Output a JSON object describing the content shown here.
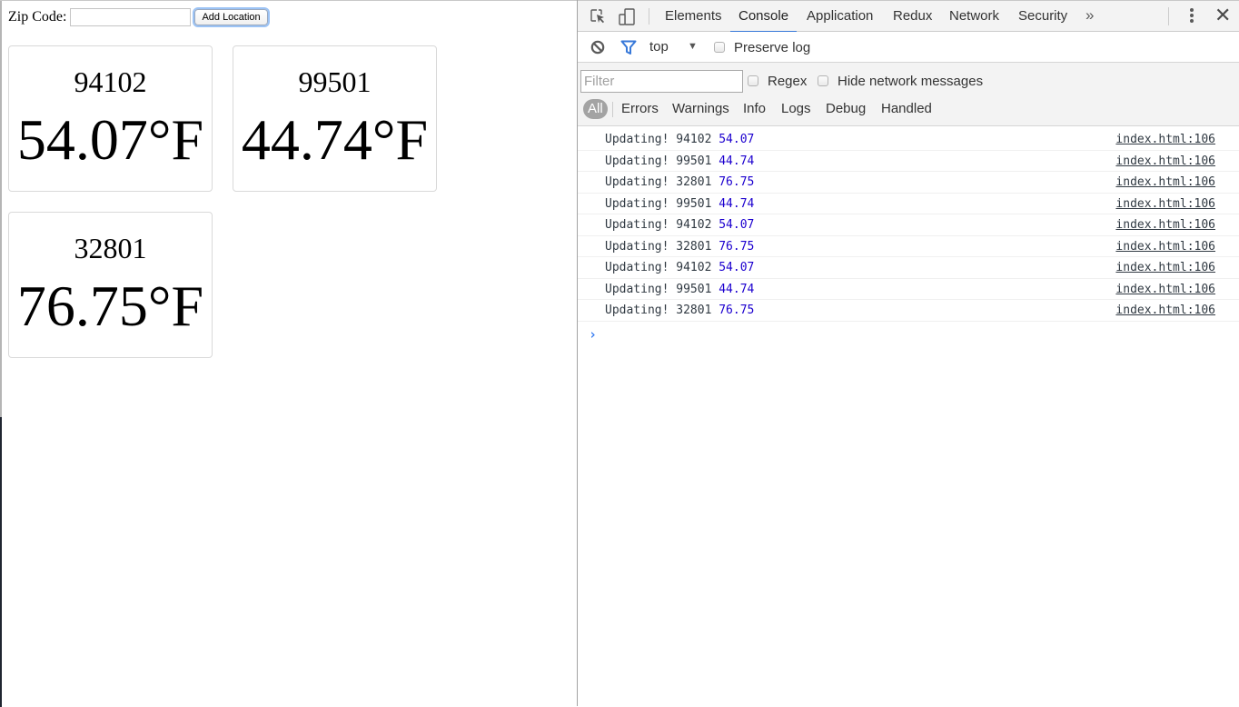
{
  "page": {
    "zip_label": "Zip Code:",
    "zip_input_value": "",
    "add_button_label": "Add Location",
    "locations": [
      {
        "zip": "94102",
        "temp": "54.07°F"
      },
      {
        "zip": "99501",
        "temp": "44.74°F"
      },
      {
        "zip": "32801",
        "temp": "76.75°F"
      }
    ]
  },
  "devtools": {
    "tabs": [
      {
        "label": "Elements",
        "active": false
      },
      {
        "label": "Console",
        "active": true
      },
      {
        "label": "Application",
        "active": false
      },
      {
        "label": "Redux",
        "active": false
      },
      {
        "label": "Network",
        "active": false
      },
      {
        "label": "Security",
        "active": false
      }
    ],
    "more_tabs_icon": "»",
    "toolbar": {
      "context": "top",
      "preserve_log_label": "Preserve log",
      "preserve_log_checked": false
    },
    "filter": {
      "placeholder": "Filter",
      "value": "",
      "regex_label": "Regex",
      "hide_network_label": "Hide network messages"
    },
    "levels": [
      "All",
      "Errors",
      "Warnings",
      "Info",
      "Logs",
      "Debug",
      "Handled"
    ],
    "active_level": "All",
    "messages": [
      {
        "prefix": "Updating! 94102",
        "value": "54.07",
        "source": "index.html:106"
      },
      {
        "prefix": "Updating! 99501",
        "value": "44.74",
        "source": "index.html:106"
      },
      {
        "prefix": "Updating! 32801",
        "value": "76.75",
        "source": "index.html:106"
      },
      {
        "prefix": "Updating! 99501",
        "value": "44.74",
        "source": "index.html:106"
      },
      {
        "prefix": "Updating! 94102",
        "value": "54.07",
        "source": "index.html:106"
      },
      {
        "prefix": "Updating! 32801",
        "value": "76.75",
        "source": "index.html:106"
      },
      {
        "prefix": "Updating! 94102",
        "value": "54.07",
        "source": "index.html:106"
      },
      {
        "prefix": "Updating! 99501",
        "value": "44.74",
        "source": "index.html:106"
      },
      {
        "prefix": "Updating! 32801",
        "value": "76.75",
        "source": "index.html:106"
      }
    ],
    "colors": {
      "accent": "#3879d9",
      "number": "#1c00cf",
      "active_level_bg": "#a3a3a3"
    }
  }
}
